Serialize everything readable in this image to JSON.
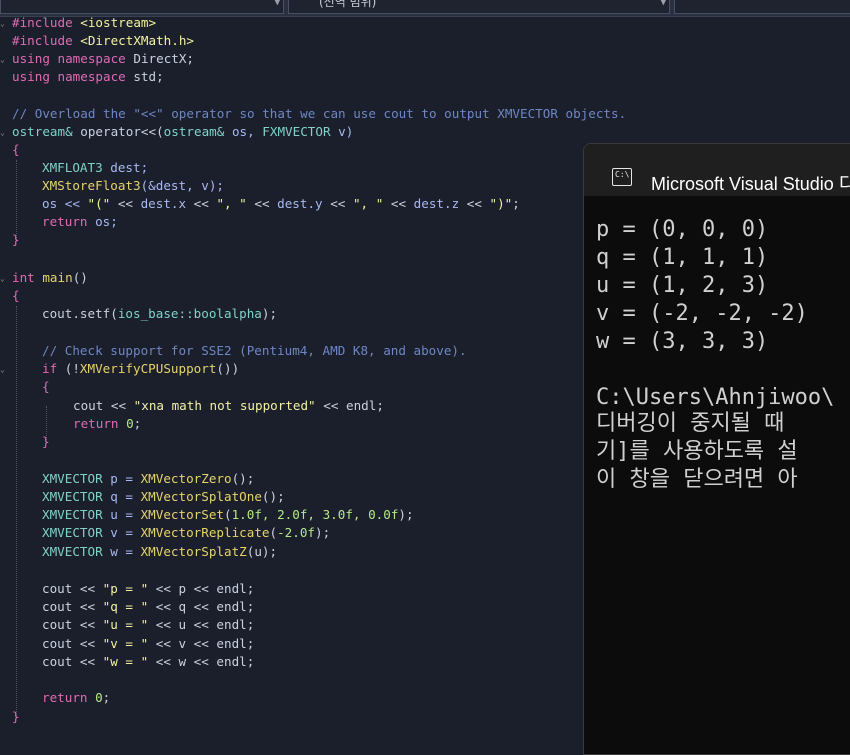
{
  "topbar": {
    "dropdowns": [
      {
        "label": ""
      },
      {
        "label": "(전역 범위)"
      },
      {
        "label": ""
      }
    ]
  },
  "code": {
    "l1": {
      "a": "#include",
      "b": "<iostream>"
    },
    "l2": {
      "a": "#include",
      "b": "<DirectXMath.h>"
    },
    "l3": {
      "a": "using",
      "b": "namespace",
      "c": "DirectX;"
    },
    "l4": {
      "a": "using",
      "b": "namespace",
      "c": "std;"
    },
    "l6": "// Overload the \"<<\" operator so that we can use cout to output XMVECTOR objects.",
    "l7": {
      "a": "ostream&",
      "b": "operator<<(",
      "c": "ostream&",
      "d": "os,",
      "e": "FXMVECTOR",
      "f": "v)"
    },
    "l8": "{",
    "l9": {
      "a": "XMFLOAT3",
      "b": "dest;"
    },
    "l10": {
      "a": "XMStoreFloat3",
      "b": "(&dest, v);"
    },
    "l11": {
      "a": "os << ",
      "b": "\"(\"",
      "c": " << ",
      "d": "dest.x",
      "e": " << ",
      "f": "\", \"",
      "g": " << ",
      "h": "dest.y",
      "i": " << ",
      "j": "\", \"",
      "k": " << ",
      "l": "dest.z",
      "m": " << ",
      "n": "\")\"",
      "o": ";"
    },
    "l12": {
      "a": "return",
      "b": " os;"
    },
    "l13": "}",
    "l15": {
      "a": "int",
      "b": "main",
      "c": "()"
    },
    "l16": "{",
    "l17": {
      "a": "cout.setf(",
      "b": "ios_base::boolalpha",
      "c": ");"
    },
    "l19": "// Check support for SSE2 (Pentium4, AMD K8, and above).",
    "l20": {
      "a": "if",
      "b": " (!",
      "c": "XMVerifyCPUSupport",
      "d": "())"
    },
    "l21": "{",
    "l22": {
      "a": "cout << ",
      "b": "\"xna math not supported\"",
      "c": " << endl;"
    },
    "l23": {
      "a": "return",
      "b": " 0",
      "c": ";"
    },
    "l24": "}",
    "l26": {
      "a": "XMVECTOR",
      "b": " p = ",
      "c": "XMVectorZero",
      "d": "();"
    },
    "l27": {
      "a": "XMVECTOR",
      "b": " q = ",
      "c": "XMVectorSplatOne",
      "d": "();"
    },
    "l28": {
      "a": "XMVECTOR",
      "b": " u = ",
      "c": "XMVectorSet",
      "d": "(",
      "e": "1.0f, 2.0f, 3.0f, 0.0f",
      "f": ");"
    },
    "l29": {
      "a": "XMVECTOR",
      "b": " v = ",
      "c": "XMVectorReplicate",
      "d": "(",
      "e": "-2.0f",
      "f": ");"
    },
    "l30": {
      "a": "XMVECTOR",
      "b": " w = ",
      "c": "XMVectorSplatZ",
      "d": "(u);"
    },
    "l32": {
      "a": "cout << ",
      "b": "\"p = \"",
      "c": " << p << endl;"
    },
    "l33": {
      "a": "cout << ",
      "b": "\"q = \"",
      "c": " << q << endl;"
    },
    "l34": {
      "a": "cout << ",
      "b": "\"u = \"",
      "c": " << u << endl;"
    },
    "l35": {
      "a": "cout << ",
      "b": "\"v = \"",
      "c": " << v << endl;"
    },
    "l36": {
      "a": "cout << ",
      "b": "\"w = \"",
      "c": " << w << endl;"
    },
    "l38": {
      "a": "return",
      "b": " 0",
      "c": ";"
    },
    "l39": "}"
  },
  "console": {
    "title": "Microsoft Visual Studio 디",
    "icon_label": "C:\\",
    "lines": [
      "p = (0, 0, 0)",
      "q = (1, 1, 1)",
      "u = (1, 2, 3)",
      "v = (-2, -2, -2)",
      "w = (3, 3, 3)",
      "",
      "C:\\Users\\Ahnjiwoo\\",
      "디버깅이 중지될 때",
      "기]를 사용하도록 설",
      "이 창을 닫으려면 아"
    ]
  }
}
